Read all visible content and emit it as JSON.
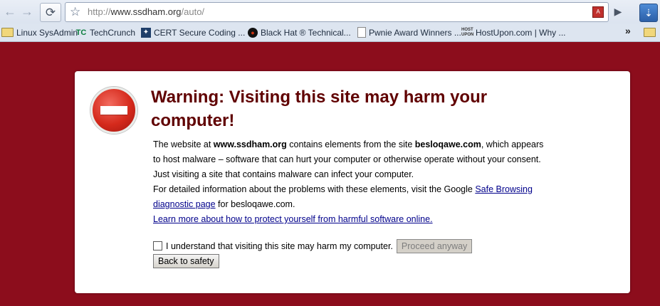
{
  "browser": {
    "url_prefix": "http://",
    "url_host": "www.ssdham.org",
    "url_path": "/auto/",
    "pdf_icon": "pdf-icon",
    "chevron": "»",
    "bookmarks": [
      {
        "icon": "folder-icon",
        "label": "Linux SysAdmin"
      },
      {
        "icon": "techcrunch-icon",
        "label": "TechCrunch"
      },
      {
        "icon": "cert-icon",
        "label": "CERT Secure Coding ..."
      },
      {
        "icon": "blackhat-icon",
        "label": "Black Hat ® Technical..."
      },
      {
        "icon": "page-icon",
        "label": "Pwnie Award Winners ..."
      },
      {
        "icon": "hostupon-icon",
        "label": "HostUpon.com | Why ..."
      }
    ]
  },
  "warning": {
    "title": "Warning: Visiting this site may harm your computer!",
    "p1_a": "The website at ",
    "p1_site": "www.ssdham.org",
    "p1_b": " contains elements from the site ",
    "p1_malware_site": "besloqawe.com",
    "p1_c": ", which appears to host malware – software that can hurt your computer or otherwise operate without your consent. Just visiting a site that contains malware can infect your computer.",
    "p2_a": "For detailed information about the problems with these elements, visit the Google ",
    "p2_link": "Safe Browsing diagnostic page",
    "p2_b": " for besloqawe.com.",
    "learn_more": "Learn more about how to protect yourself from harmful software online.",
    "checkbox_label": "I understand that visiting this site may harm my computer.",
    "proceed_label": "Proceed anyway",
    "back_label": "Back to safety"
  },
  "colors": {
    "page_background": "#8c0d1c",
    "title": "#600000",
    "link": "#00008b"
  }
}
